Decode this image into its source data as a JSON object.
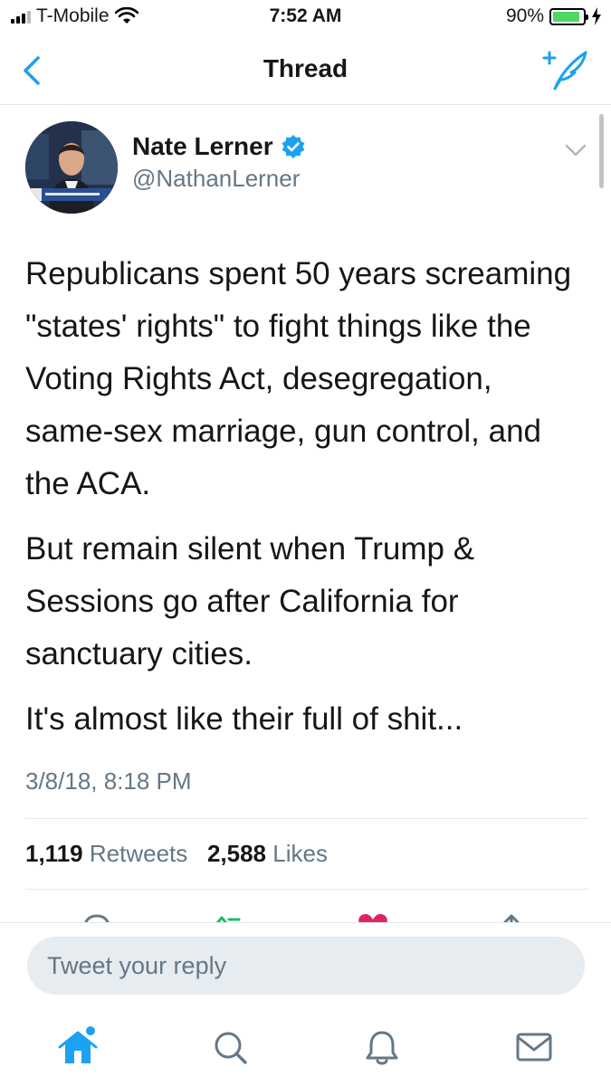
{
  "status_bar": {
    "carrier": "T-Mobile",
    "time": "7:52 AM",
    "battery": "90%"
  },
  "nav": {
    "title": "Thread"
  },
  "tweet": {
    "name": "Nate Lerner",
    "handle": "@NathanLerner",
    "body": [
      "Republicans spent 50 years screaming \"states' rights\" to fight things like the Voting Rights Act, desegregation, same-sex marriage, gun control, and the ACA.",
      "But remain silent when Trump & Sessions go after California for sanctuary cities.",
      "It's almost like their full of shit..."
    ],
    "timestamp": "3/8/18, 8:18 PM",
    "retweets_count": "1,119",
    "retweets_label": "Retweets",
    "likes_count": "2,588",
    "likes_label": "Likes"
  },
  "reply": {
    "placeholder": "Tweet your reply"
  },
  "tabs": [
    {
      "icon": "home-icon"
    },
    {
      "icon": "search-icon"
    },
    {
      "icon": "bell-icon"
    },
    {
      "icon": "mail-icon"
    }
  ],
  "colors": {
    "accent": "#1da1f2",
    "retweet": "#17bf63",
    "like": "#e0245e",
    "muted": "#657786"
  }
}
